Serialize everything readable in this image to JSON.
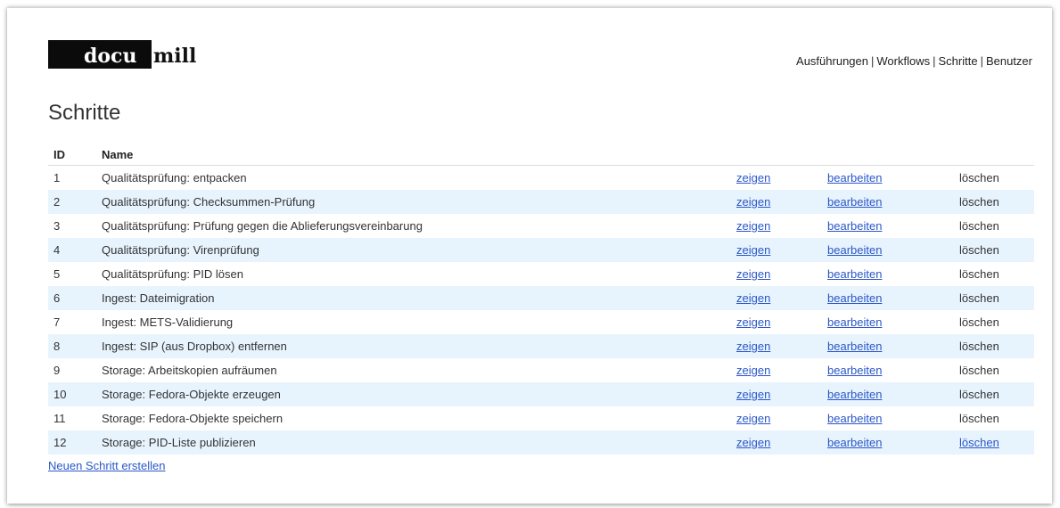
{
  "brand": {
    "part1": "docu",
    "part2": "mill"
  },
  "nav": {
    "items": [
      "Ausführungen",
      "Workflows",
      "Schritte",
      "Benutzer"
    ],
    "separator": "|"
  },
  "page": {
    "title": "Schritte"
  },
  "table": {
    "headers": {
      "id": "ID",
      "name": "Name"
    },
    "action_labels": {
      "show": "zeigen",
      "edit": "bearbeiten",
      "delete": "löschen"
    },
    "rows": [
      {
        "id": "1",
        "name": "Qualitätsprüfung: entpacken",
        "delete_is_link": false
      },
      {
        "id": "2",
        "name": "Qualitätsprüfung: Checksummen-Prüfung",
        "delete_is_link": false
      },
      {
        "id": "3",
        "name": "Qualitätsprüfung: Prüfung gegen die Ablieferungsvereinbarung",
        "delete_is_link": false
      },
      {
        "id": "4",
        "name": "Qualitätsprüfung: Virenprüfung",
        "delete_is_link": false
      },
      {
        "id": "5",
        "name": "Qualitätsprüfung: PID lösen",
        "delete_is_link": false
      },
      {
        "id": "6",
        "name": "Ingest: Dateimigration",
        "delete_is_link": false
      },
      {
        "id": "7",
        "name": "Ingest: METS-Validierung",
        "delete_is_link": false
      },
      {
        "id": "8",
        "name": "Ingest: SIP (aus Dropbox) entfernen",
        "delete_is_link": false
      },
      {
        "id": "9",
        "name": "Storage: Arbeitskopien aufräumen",
        "delete_is_link": false
      },
      {
        "id": "10",
        "name": "Storage: Fedora-Objekte erzeugen",
        "delete_is_link": false
      },
      {
        "id": "11",
        "name": "Storage: Fedora-Objekte speichern",
        "delete_is_link": false
      },
      {
        "id": "12",
        "name": "Storage: PID-Liste publizieren",
        "delete_is_link": true
      }
    ]
  },
  "footer": {
    "new_link": "Neuen Schritt erstellen"
  },
  "colors": {
    "link": "#2a57c8",
    "row_stripe": "#e8f4fd",
    "logo_bg": "#0b0b0b"
  }
}
